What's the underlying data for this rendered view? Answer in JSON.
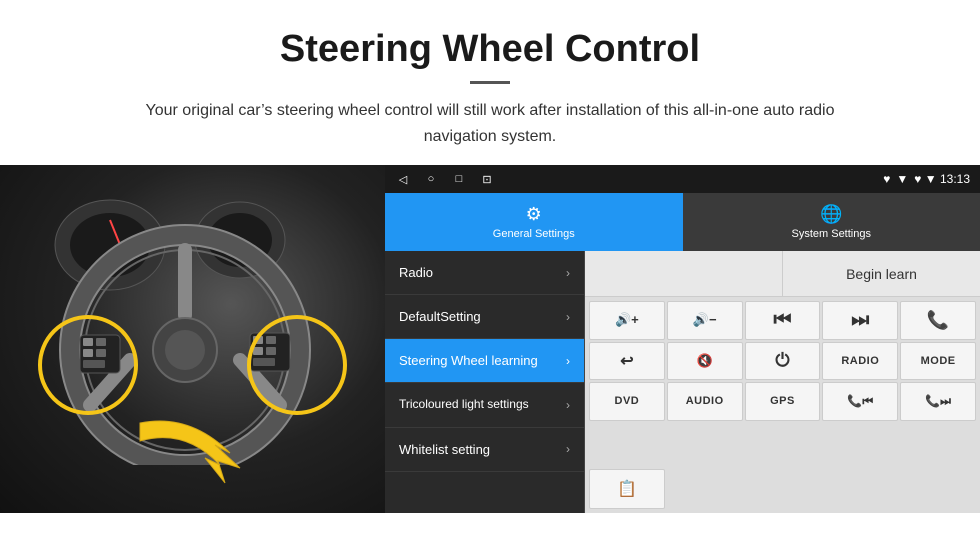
{
  "header": {
    "title": "Steering Wheel Control",
    "divider": true,
    "subtitle": "Your original car’s steering wheel control will still work after installation of this all-in-one auto radio navigation system."
  },
  "status_bar": {
    "icons": [
      "◁",
      "○",
      "□",
      "⊡"
    ],
    "right": "♥ ▼  13:13"
  },
  "tabs": [
    {
      "id": "general",
      "label": "General Settings",
      "icon": "⚙",
      "active": true
    },
    {
      "id": "system",
      "label": "System Settings",
      "icon": "🌐",
      "active": false
    }
  ],
  "menu_items": [
    {
      "label": "Radio",
      "active": false
    },
    {
      "label": "DefaultSetting",
      "active": false
    },
    {
      "label": "Steering Wheel learning",
      "active": true
    },
    {
      "label": "Tricoloured light settings",
      "active": false
    },
    {
      "label": "Whitelist setting",
      "active": false
    }
  ],
  "controls": {
    "begin_learn": "Begin learn",
    "grid_buttons": [
      {
        "type": "icon",
        "content": "🔊+"
      },
      {
        "type": "icon",
        "content": "🔊−"
      },
      {
        "type": "icon",
        "content": "⏮"
      },
      {
        "type": "icon",
        "content": "⏭"
      },
      {
        "type": "icon",
        "content": "📞"
      },
      {
        "type": "icon",
        "content": "↩"
      },
      {
        "type": "icon",
        "content": "🔊✕"
      },
      {
        "type": "icon",
        "content": "⏻"
      },
      {
        "type": "text",
        "content": "RADIO"
      },
      {
        "type": "text",
        "content": "MODE"
      },
      {
        "type": "text",
        "content": "DVD"
      },
      {
        "type": "text",
        "content": "AUDIO"
      },
      {
        "type": "text",
        "content": "GPS"
      },
      {
        "type": "icon",
        "content": "📞⏮"
      },
      {
        "type": "icon",
        "content": "📞⏭"
      }
    ],
    "last_row": [
      {
        "type": "icon",
        "content": "📋"
      }
    ]
  }
}
